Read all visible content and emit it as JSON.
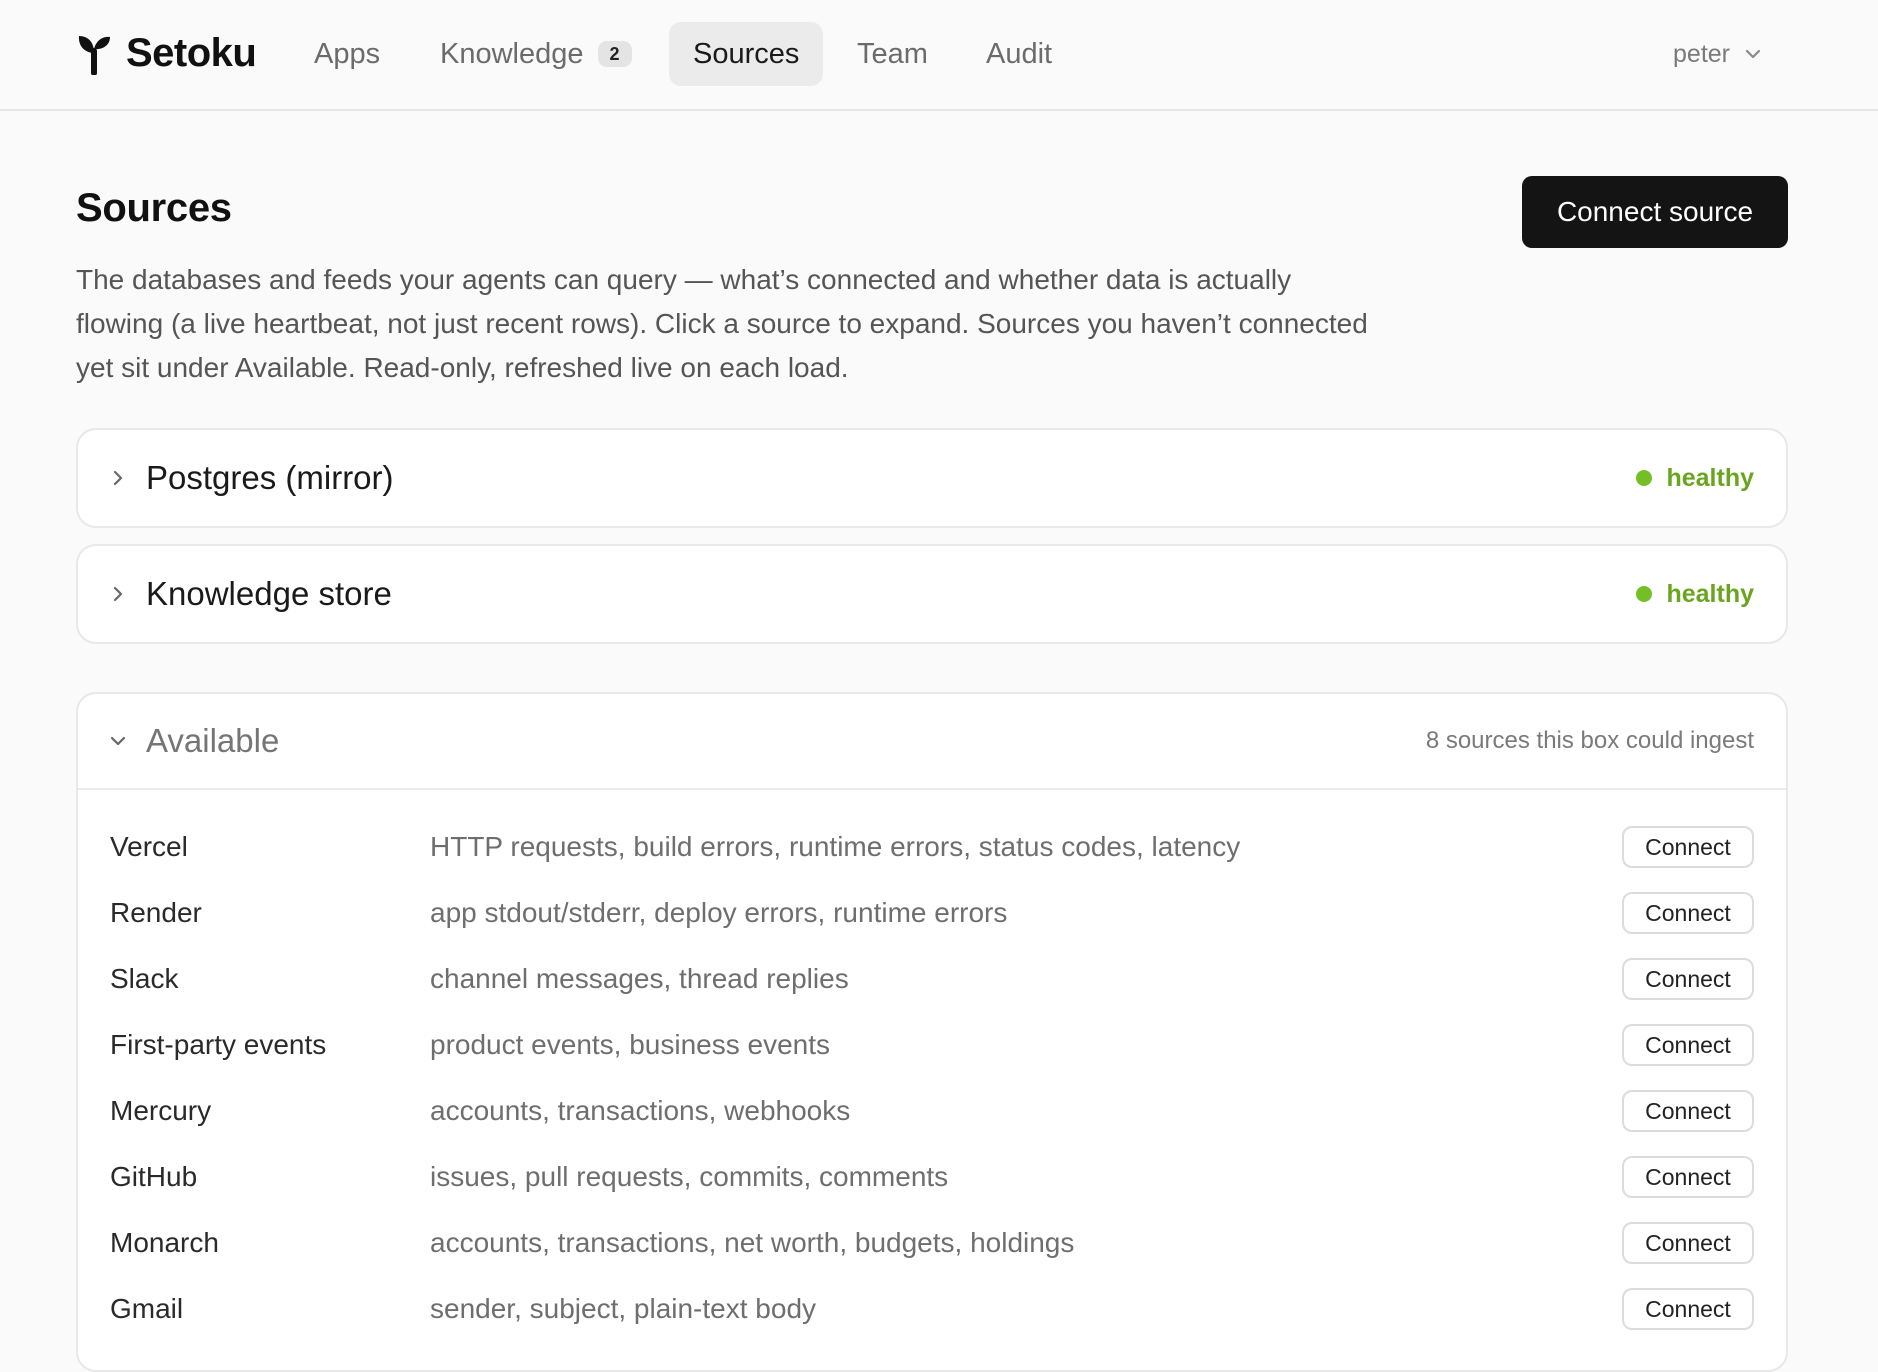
{
  "brand": {
    "name": "Setoku"
  },
  "nav": {
    "items": [
      {
        "label": "Apps"
      },
      {
        "label": "Knowledge",
        "badge": "2"
      },
      {
        "label": "Sources"
      },
      {
        "label": "Team"
      },
      {
        "label": "Audit"
      }
    ],
    "active": "Sources",
    "user": "peter"
  },
  "header": {
    "title": "Sources",
    "description": "The databases and feeds your agents can query — what’s connected and whether data is actually flowing (a live heartbeat, not just recent rows). Click a source to expand. Sources you haven’t connected yet sit under Available. Read-only, refreshed live on each load.",
    "connect_label": "Connect source"
  },
  "connected": [
    {
      "name": "Postgres (mirror)",
      "status": "healthy"
    },
    {
      "name": "Knowledge store",
      "status": "healthy"
    }
  ],
  "available": {
    "title": "Available",
    "meta": "8 sources this box could ingest",
    "connect_label": "Connect",
    "sources": [
      {
        "name": "Vercel",
        "desc": "HTTP requests, build errors, runtime errors, status codes, latency"
      },
      {
        "name": "Render",
        "desc": "app stdout/stderr, deploy errors, runtime errors"
      },
      {
        "name": "Slack",
        "desc": "channel messages, thread replies"
      },
      {
        "name": "First-party events",
        "desc": "product events, business events"
      },
      {
        "name": "Mercury",
        "desc": "accounts, transactions, webhooks"
      },
      {
        "name": "GitHub",
        "desc": "issues, pull requests, commits, comments"
      },
      {
        "name": "Monarch",
        "desc": "accounts, transactions, net worth, budgets, holdings"
      },
      {
        "name": "Gmail",
        "desc": "sender, subject, plain-text body"
      }
    ]
  },
  "colors": {
    "healthy": "#6aa51f",
    "primary_button": "#141414",
    "active_nav": "#ebebeb"
  }
}
